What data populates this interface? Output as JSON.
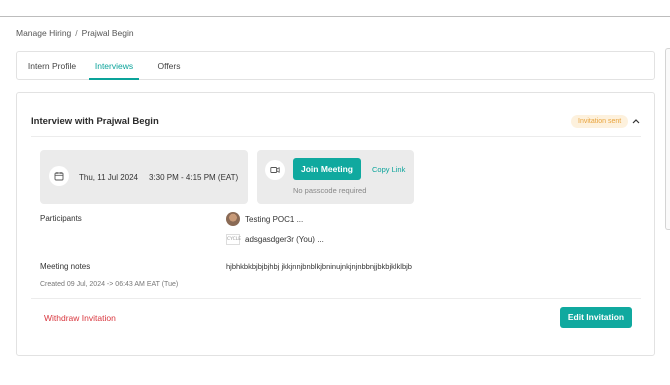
{
  "breadcrumb": {
    "parent": "Manage Hiring",
    "separator": "/",
    "current": "Prajwal Begin"
  },
  "tabs": [
    {
      "label": "Intern Profile",
      "active": false
    },
    {
      "label": "Interviews",
      "active": true
    },
    {
      "label": "Offers",
      "active": false
    }
  ],
  "interview": {
    "title": "Interview with Prajwal Begin",
    "status_badge": "Invitation sent",
    "date": "Thu, 11 Jul 2024",
    "time": "3:30 PM - 4:15 PM (EAT)",
    "join_label": "Join Meeting",
    "copy_link_label": "Copy Link",
    "passcode_note": "No passcode required",
    "participants_label": "Participants",
    "participants": [
      {
        "name": "Testing POC1 ...",
        "avatar": "photo"
      },
      {
        "name": "adsgasdger3r (You) ...",
        "avatar_text": "CYCLE"
      }
    ],
    "notes_label": "Meeting notes",
    "notes_value": "hjbhkbkbjbjbjhbj jkkjnnjbnblkjbninujnkjnjnbbnjjbkbjklklbjb",
    "created": "Created 09 Jul, 2024 -> 06:43 AM EAT (Tue)",
    "withdraw_label": "Withdraw Invitation",
    "edit_label": "Edit Invitation"
  },
  "colors": {
    "accent": "#10a99f",
    "danger": "#d9363e",
    "badge_bg": "#fdf1dd",
    "badge_text": "#e8a33c"
  },
  "icons": [
    "calendar-icon",
    "video-camera-icon",
    "chevron-up-icon"
  ]
}
